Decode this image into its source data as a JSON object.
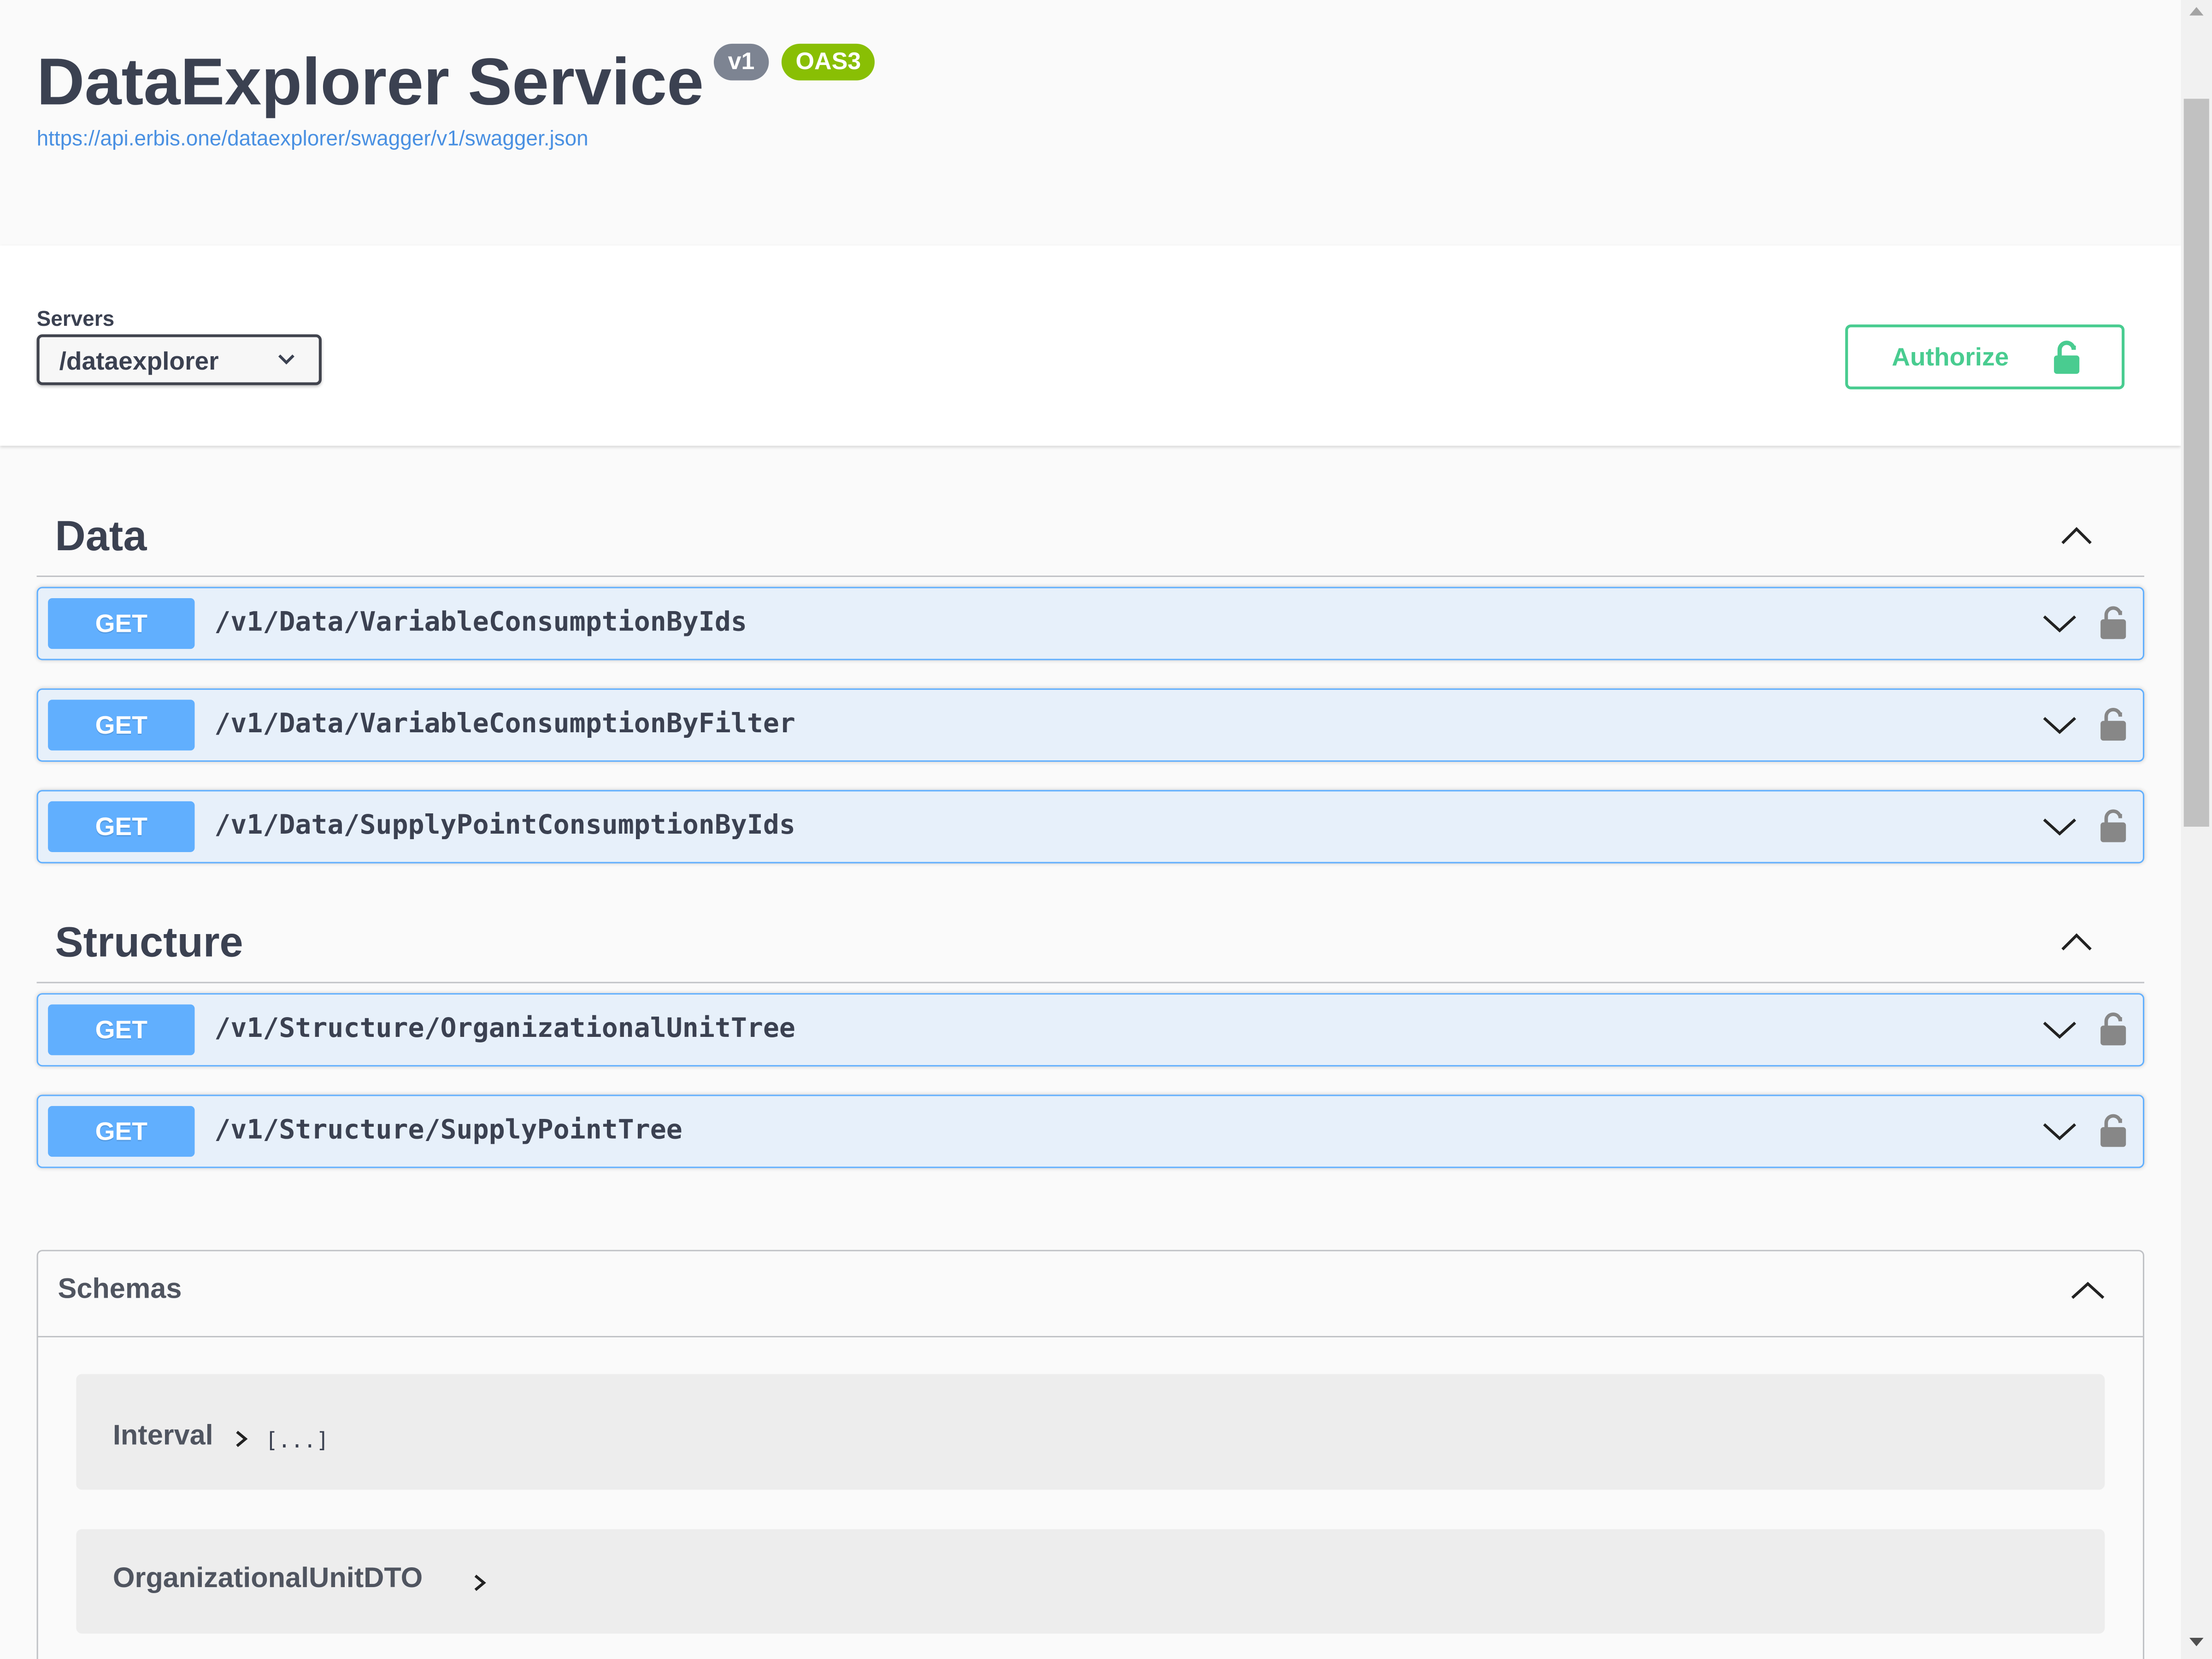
{
  "info": {
    "title": "DataExplorer Service",
    "version_badge": "v1",
    "oas_badge": "OAS3",
    "spec_url": "https://api.erbis.one/dataexplorer/swagger/v1/swagger.json"
  },
  "servers": {
    "label": "Servers",
    "selected": "/dataexplorer"
  },
  "authorize": {
    "label": "Authorize"
  },
  "tags": [
    {
      "name": "Data",
      "operations": [
        {
          "method": "GET",
          "path": "/v1/Data/VariableConsumptionByIds"
        },
        {
          "method": "GET",
          "path": "/v1/Data/VariableConsumptionByFilter"
        },
        {
          "method": "GET",
          "path": "/v1/Data/SupplyPointConsumptionByIds"
        }
      ]
    },
    {
      "name": "Structure",
      "operations": [
        {
          "method": "GET",
          "path": "/v1/Structure/OrganizationalUnitTree"
        },
        {
          "method": "GET",
          "path": "/v1/Structure/SupplyPointTree"
        }
      ]
    }
  ],
  "schemas": {
    "title": "Schemas",
    "items": [
      {
        "name": "Interval",
        "hint": "[...]"
      },
      {
        "name": "OrganizationalUnitDTO",
        "hint": ""
      }
    ]
  },
  "colors": {
    "get_method": "#61affe",
    "authorize": "#49cc90",
    "oas_badge": "#89bf04",
    "version_badge": "#7d8492",
    "link": "#4990e2"
  },
  "icons": {
    "lock": "lock-icon",
    "chevron": "chevron-icon"
  }
}
